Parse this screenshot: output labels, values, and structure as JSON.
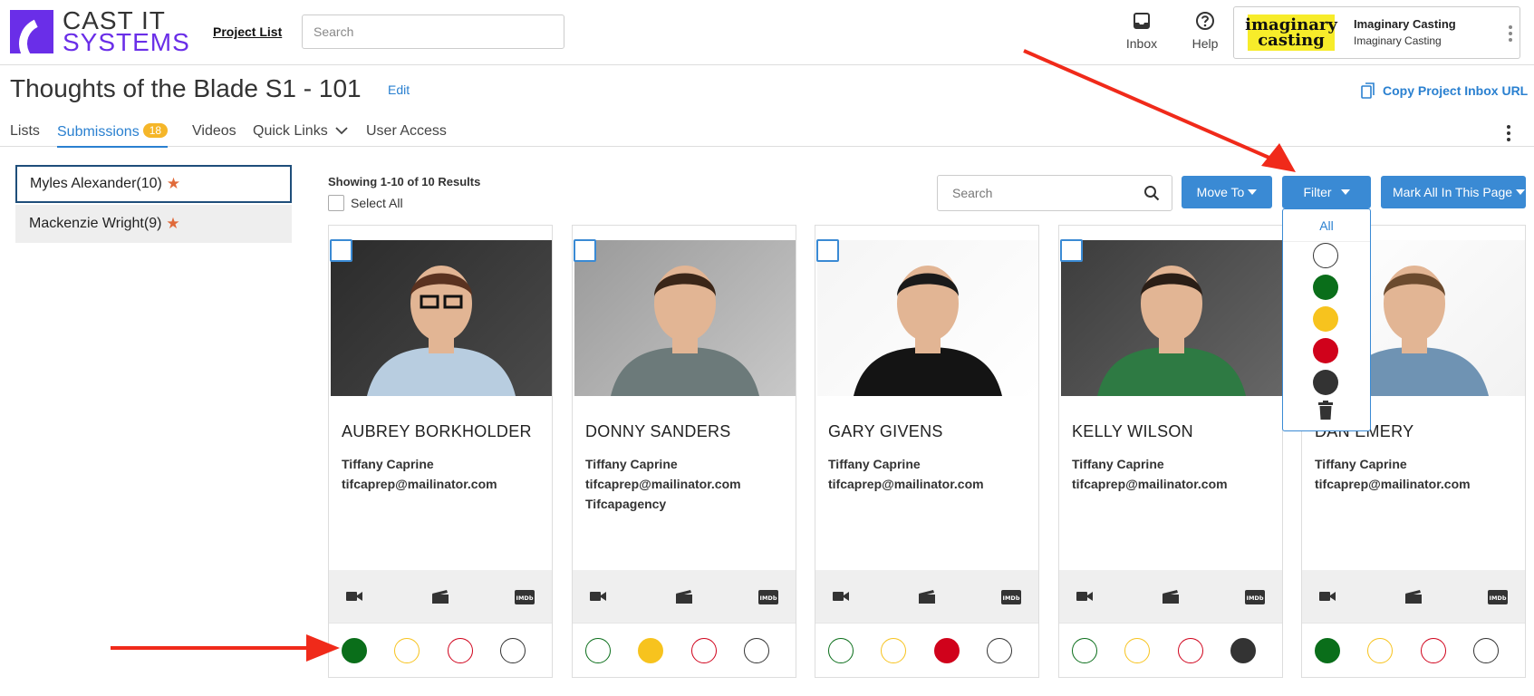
{
  "header": {
    "logo_line1": "CAST IT",
    "logo_line2": "SYSTEMS",
    "project_list": "Project List",
    "search_placeholder": "Search",
    "inbox": "Inbox",
    "help": "Help",
    "account_logo_line1": "imaginary",
    "account_logo_line2": "casting",
    "account_name": "Imaginary Casting",
    "account_sub": "Imaginary Casting"
  },
  "project": {
    "title": "Thoughts of the Blade S1 - 101",
    "edit": "Edit",
    "copy_url": "Copy Project Inbox URL"
  },
  "tabs": {
    "lists": "Lists",
    "submissions": "Submissions",
    "submissions_count": "18",
    "videos": "Videos",
    "quick_links": "Quick Links",
    "user_access": "User Access"
  },
  "roles": [
    {
      "label": "Myles Alexander(10)"
    },
    {
      "label": "Mackenzie Wright(9)"
    }
  ],
  "results": {
    "showing": "Showing 1-10 of 10 Results",
    "select_all": "Select All",
    "search_placeholder": "Search",
    "move_to": "Move To",
    "filter": "Filter",
    "mark_all": "Mark All In This Page"
  },
  "filter_menu": {
    "all": "All",
    "options": [
      "white",
      "green",
      "yellow",
      "red",
      "black",
      "delete"
    ]
  },
  "colors": {
    "green": "#0a6e1a",
    "yellow": "#f7c31e",
    "red": "#d0021b",
    "black": "#333333",
    "accent": "#3a8ad4"
  },
  "cards": [
    {
      "name": "AUBREY BORKHOLDER",
      "agent": "Tiffany Caprine",
      "email": "tifcaprep@mailinator.com",
      "agency": "",
      "selected_color": "green"
    },
    {
      "name": "DONNY SANDERS",
      "agent": "Tiffany Caprine",
      "email": "tifcaprep@mailinator.com",
      "agency": "Tifcapagency",
      "selected_color": "yellow"
    },
    {
      "name": "GARY GIVENS",
      "agent": "Tiffany Caprine",
      "email": "tifcaprep@mailinator.com",
      "agency": "",
      "selected_color": "red"
    },
    {
      "name": "KELLY WILSON",
      "agent": "Tiffany Caprine",
      "email": "tifcaprep@mailinator.com",
      "agency": "",
      "selected_color": "black"
    },
    {
      "name": "DAN EMERY",
      "agent": "Tiffany Caprine",
      "email": "tifcaprep@mailinator.com",
      "agency": "",
      "selected_color": "green"
    }
  ]
}
